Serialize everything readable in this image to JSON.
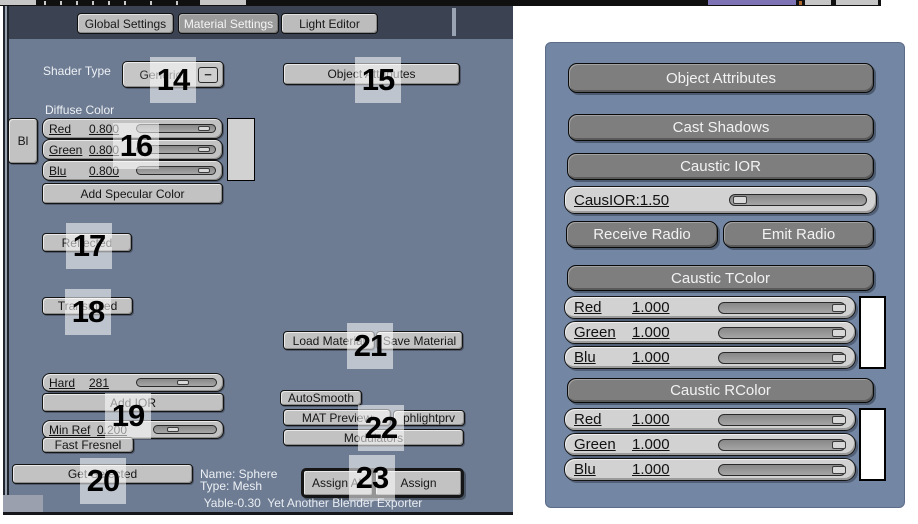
{
  "colors": {
    "left_panel_bg": "#6d7c93",
    "right_panel_bg": "#7386a3",
    "tabrow_bg": "#3b4252",
    "button_light": "#c2c2c2",
    "button_dark": "#7e7e7e",
    "topstrip_purple": "#7e74b5"
  },
  "top_tabs": {
    "global": "Global Settings",
    "material": "Material Settings",
    "light": "Light Editor"
  },
  "material_panel": {
    "shader_type_label": "Shader Type",
    "shader_type_value": "Generic",
    "shader_type_menu_glyph": "−",
    "object_attributes_button": "Object Attributes",
    "diffuse_color_label": "Diffuse Color",
    "bl_button": "Bl",
    "sliders": {
      "red": {
        "label": "Red",
        "value": "0.800"
      },
      "green": {
        "label": "Green",
        "value": "0.800"
      },
      "blu": {
        "label": "Blu",
        "value": "0.800"
      },
      "hard": {
        "label": "Hard",
        "value": "281"
      },
      "min_ref": {
        "label": "Min Ref",
        "value": "0.200"
      }
    },
    "add_specular_button": "Add Specular Color",
    "reflected_button": "Reflected",
    "transmited_button": "Transmited",
    "add_ior_button": "Add IOR",
    "fast_fresnel_button": "Fast Fresnel",
    "get_selected_button": "Get Selected",
    "object_name": "Name: Sphere",
    "object_type": "Type: Mesh",
    "load_material_button": "Load Material",
    "save_material_button": "Save Material",
    "autosmooth_button": "AutoSmooth",
    "mat_preview_button": "MAT Preview",
    "phlightprv_button": "phlightprv",
    "modulators_button": "Modulators",
    "assign_all_button": "Assign All",
    "assign_button": "Assign",
    "footer": "Yable-0.30  Yet Another Blender Exporter"
  },
  "object_attributes_popup": {
    "title_button": "Object Attributes",
    "cast_shadows_button": "Cast Shadows",
    "caustic_ior_button": "Caustic IOR",
    "caus_ior_slider": "CausIOR:1.50",
    "receive_radio_button": "Receive Radio",
    "emit_radio_button": "Emit Radio",
    "caustic_tcolor_button": "Caustic TColor",
    "tcolor": {
      "red": {
        "label": "Red",
        "value": "1.000"
      },
      "green": {
        "label": "Green",
        "value": "1.000"
      },
      "blu": {
        "label": "Blu",
        "value": "1.000"
      }
    },
    "caustic_rcolor_button": "Caustic RColor",
    "rcolor": {
      "red": {
        "label": "Red",
        "value": "1.000"
      },
      "green": {
        "label": "Green",
        "value": "1.000"
      },
      "blu": {
        "label": "Blu",
        "value": "1.000"
      }
    }
  },
  "annotations": {
    "n14": "14",
    "n15": "15",
    "n16": "16",
    "n17": "17",
    "n18": "18",
    "n19": "19",
    "n20": "20",
    "n21": "21",
    "n22": "22",
    "n23": "23"
  }
}
